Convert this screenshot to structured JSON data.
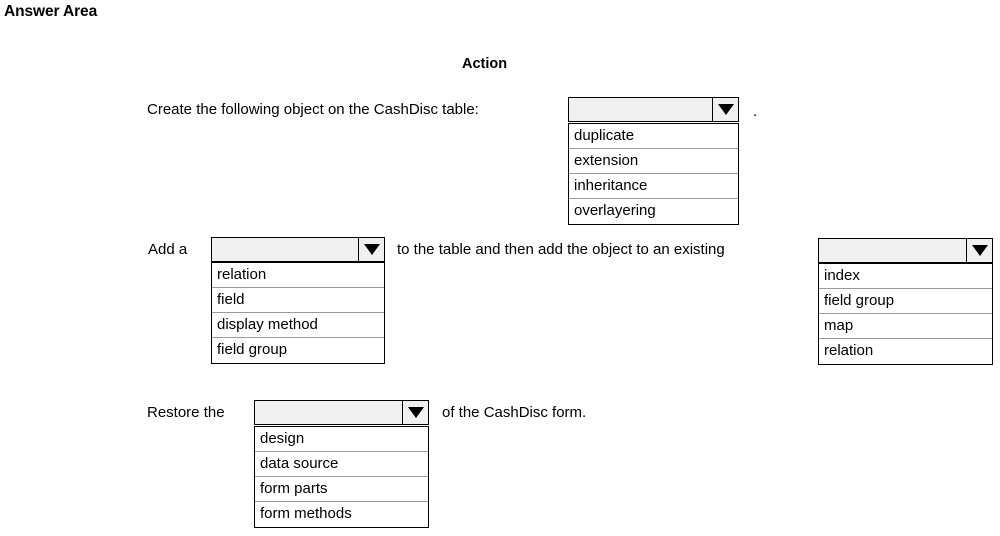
{
  "page": {
    "title": "Answer Area"
  },
  "table": {
    "column_header": "Action"
  },
  "rows": [
    {
      "id": "row-create-object",
      "text_before": "Create the following object on the CashDisc table:",
      "text_after": ".",
      "dropdown": {
        "name": "object-type-dropdown",
        "selected": "",
        "options": [
          "duplicate",
          "extension",
          "inheritance",
          "overlayering"
        ]
      }
    },
    {
      "id": "row-add-to-table",
      "text_before": "Add a",
      "text_middle": "to the table and then add the object to an existing",
      "dropdown_left": {
        "name": "table-element-dropdown",
        "selected": "",
        "options": [
          "relation",
          "field",
          "display method",
          "field group"
        ]
      },
      "dropdown_right": {
        "name": "existing-object-dropdown",
        "selected": "",
        "options": [
          "index",
          "field group",
          "map",
          "relation"
        ]
      }
    },
    {
      "id": "row-restore-form",
      "text_before": "Restore the",
      "text_after": "of the CashDisc form.",
      "dropdown": {
        "name": "form-part-dropdown",
        "selected": "",
        "options": [
          "design",
          "data source",
          "form parts",
          "form methods"
        ]
      }
    }
  ]
}
